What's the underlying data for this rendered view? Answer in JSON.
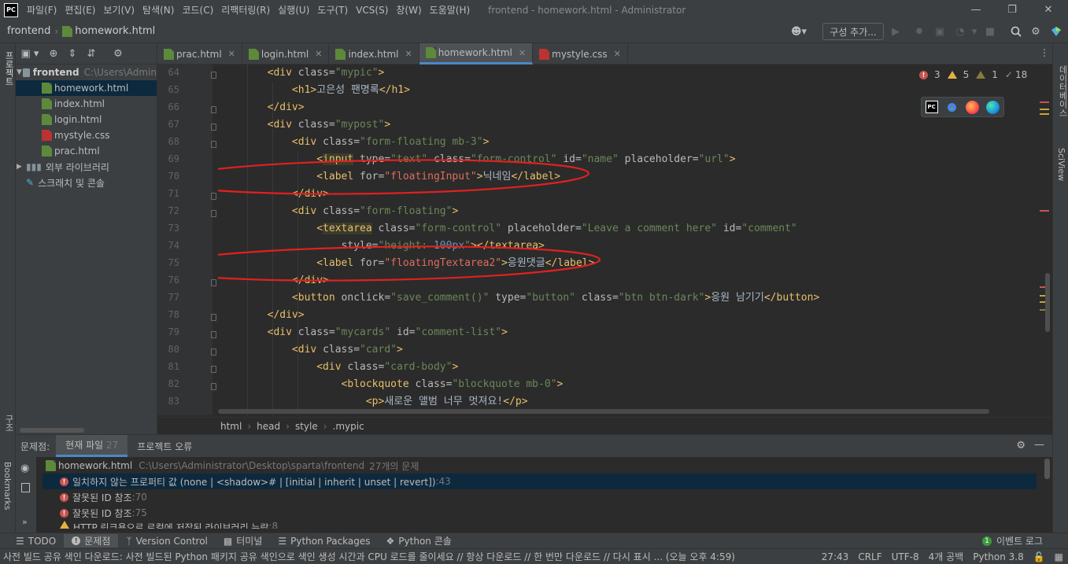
{
  "menubar": {
    "app_icon": "PC",
    "items": [
      "파일(F)",
      "편집(E)",
      "보기(V)",
      "탐색(N)",
      "코드(C)",
      "리팩터링(R)",
      "실행(U)",
      "도구(T)",
      "VCS(S)",
      "창(W)",
      "도움말(H)"
    ],
    "window_title": "frontend - homework.html - Administrator"
  },
  "navbar": {
    "breadcrumb": [
      "frontend",
      "homework.html"
    ],
    "config_button": "구성 추가..."
  },
  "project": {
    "root_name": "frontend",
    "root_path": "C:\\Users\\Admin",
    "files": [
      "homework.html",
      "index.html",
      "login.html",
      "mystyle.css",
      "prac.html"
    ],
    "external_libs": "외부 라이브러리",
    "scratches": "스크래치 및 콘솔",
    "side_label": "프로젝트",
    "structure_label": "구조",
    "bookmarks_label": "Bookmarks"
  },
  "tabs": [
    {
      "label": "prac.html",
      "type": "html"
    },
    {
      "label": "login.html",
      "type": "html"
    },
    {
      "label": "index.html",
      "type": "html"
    },
    {
      "label": "homework.html",
      "type": "html",
      "active": true
    },
    {
      "label": "mystyle.css",
      "type": "css"
    }
  ],
  "right_strip": {
    "database": "데이터베이스",
    "sciview": "SciView"
  },
  "inspections": {
    "errors": "3",
    "warnings": "5",
    "weak_warnings": "1",
    "typos": "18"
  },
  "editor": {
    "line_numbers": [
      "64",
      "65",
      "66",
      "67",
      "68",
      "69",
      "70",
      "71",
      "72",
      "73",
      "74",
      "75",
      "76",
      "77",
      "78",
      "79",
      "80",
      "81",
      "82",
      "83"
    ],
    "annotation_color": "#e0211f"
  },
  "code_breadcrumb": [
    "html",
    "head",
    "style",
    ".mypic"
  ],
  "problems": {
    "title": "문제점:",
    "tab_current": "현재 파일",
    "tab_current_count": "27",
    "tab_project": "프로젝트 오류",
    "file": "homework.html",
    "file_path": "C:\\Users\\Administrator\\Desktop\\sparta\\frontend",
    "file_count": "27개의 문제",
    "rows": [
      {
        "text": "일치하지 않는 프로퍼티 값 (none | <shadow># | [initial | inherit | unset | revert])",
        "loc": ":43",
        "level": "error"
      },
      {
        "text": "잘못된 ID 참조",
        "loc": ":70",
        "level": "error"
      },
      {
        "text": "잘못된 ID 참조",
        "loc": ":75",
        "level": "error"
      },
      {
        "text": "HTTP 링크용으로 로컬에 저장된 라이브러리 누락",
        "loc": ":8",
        "level": "warning"
      }
    ]
  },
  "toolwindows": [
    "TODO",
    "문제점",
    "Version Control",
    "터미널",
    "Python Packages",
    "Python 콘솔"
  ],
  "event_log": {
    "count": "1",
    "label": "이벤트 로그"
  },
  "statusbar": {
    "message": "사전 빌드 공유 색인 다운로드: 사전 빌드된 Python 패키지 공유 색인으로 색인 생성 시간과 CPU 로드를 줄이세요 // 항상 다운로드 // 한 번만 다운로드 // 다시 표시 ... (오늘 오후 4:59)",
    "position": "27:43",
    "line_sep": "CRLF",
    "encoding": "UTF-8",
    "indent": "4개 공백",
    "interpreter": "Python 3.8"
  },
  "colors": {
    "accent": "#4a88c7",
    "error": "#c75450",
    "warning": "#e3b341",
    "tag": "#e8bf6a",
    "string": "#6a8759"
  }
}
